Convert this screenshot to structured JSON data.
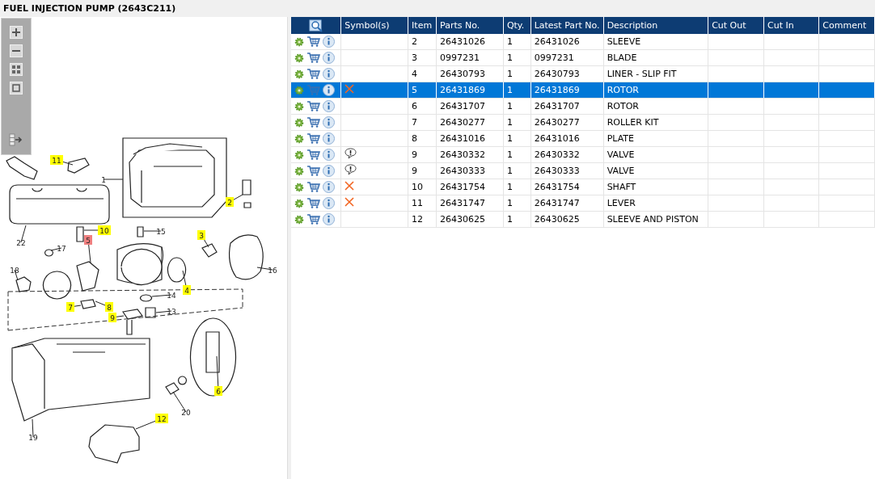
{
  "title": "FUEL INJECTION PUMP (2643C211)",
  "diagram": {
    "callouts": [
      {
        "label": "11",
        "highlighted": true,
        "selected": false
      },
      {
        "label": "1",
        "highlighted": false,
        "selected": false
      },
      {
        "label": "2",
        "highlighted": true,
        "selected": false
      },
      {
        "label": "22",
        "highlighted": false,
        "selected": false
      },
      {
        "label": "10",
        "highlighted": true,
        "selected": false
      },
      {
        "label": "15",
        "highlighted": false,
        "selected": false
      },
      {
        "label": "3",
        "highlighted": true,
        "selected": false
      },
      {
        "label": "17",
        "highlighted": false,
        "selected": false
      },
      {
        "label": "5",
        "highlighted": true,
        "selected": true
      },
      {
        "label": "16",
        "highlighted": false,
        "selected": false
      },
      {
        "label": "18",
        "highlighted": false,
        "selected": false
      },
      {
        "label": "4",
        "highlighted": true,
        "selected": false
      },
      {
        "label": "14",
        "highlighted": false,
        "selected": false
      },
      {
        "label": "7",
        "highlighted": true,
        "selected": false
      },
      {
        "label": "8",
        "highlighted": true,
        "selected": false
      },
      {
        "label": "13",
        "highlighted": false,
        "selected": false
      },
      {
        "label": "9",
        "highlighted": true,
        "selected": false
      },
      {
        "label": "6",
        "highlighted": true,
        "selected": false
      },
      {
        "label": "20",
        "highlighted": false,
        "selected": false
      },
      {
        "label": "19",
        "highlighted": false,
        "selected": false
      },
      {
        "label": "12",
        "highlighted": true,
        "selected": false
      }
    ]
  },
  "table": {
    "columns": [
      "Symbol(s)",
      "Item",
      "Parts No.",
      "Qty.",
      "Latest Part No.",
      "Description",
      "Cut Out",
      "Cut In",
      "Comment"
    ],
    "rows": [
      {
        "selected": false,
        "cross_symbol": false,
        "note_symbol": false,
        "item": "2",
        "part_no": "26431026",
        "qty": "1",
        "latest_part_no": "26431026",
        "description": "SLEEVE"
      },
      {
        "selected": false,
        "cross_symbol": false,
        "note_symbol": false,
        "item": "3",
        "part_no": "0997231",
        "qty": "1",
        "latest_part_no": "0997231",
        "description": "BLADE"
      },
      {
        "selected": false,
        "cross_symbol": false,
        "note_symbol": false,
        "item": "4",
        "part_no": "26430793",
        "qty": "1",
        "latest_part_no": "26430793",
        "description": "LINER - SLIP FIT"
      },
      {
        "selected": true,
        "cross_symbol": true,
        "note_symbol": false,
        "item": "5",
        "part_no": "26431869",
        "qty": "1",
        "latest_part_no": "26431869",
        "description": "ROTOR"
      },
      {
        "selected": false,
        "cross_symbol": false,
        "note_symbol": false,
        "item": "6",
        "part_no": "26431707",
        "qty": "1",
        "latest_part_no": "26431707",
        "description": "ROTOR"
      },
      {
        "selected": false,
        "cross_symbol": false,
        "note_symbol": false,
        "item": "7",
        "part_no": "26430277",
        "qty": "1",
        "latest_part_no": "26430277",
        "description": "ROLLER KIT"
      },
      {
        "selected": false,
        "cross_symbol": false,
        "note_symbol": false,
        "item": "8",
        "part_no": "26431016",
        "qty": "1",
        "latest_part_no": "26431016",
        "description": "PLATE"
      },
      {
        "selected": false,
        "cross_symbol": false,
        "note_symbol": true,
        "item": "9",
        "part_no": "26430332",
        "qty": "1",
        "latest_part_no": "26430332",
        "description": "VALVE"
      },
      {
        "selected": false,
        "cross_symbol": false,
        "note_symbol": true,
        "item": "9",
        "part_no": "26430333",
        "qty": "1",
        "latest_part_no": "26430333",
        "description": "VALVE"
      },
      {
        "selected": false,
        "cross_symbol": true,
        "note_symbol": false,
        "item": "10",
        "part_no": "26431754",
        "qty": "1",
        "latest_part_no": "26431754",
        "description": "SHAFT"
      },
      {
        "selected": false,
        "cross_symbol": true,
        "note_symbol": false,
        "item": "11",
        "part_no": "26431747",
        "qty": "1",
        "latest_part_no": "26431747",
        "description": "LEVER"
      },
      {
        "selected": false,
        "cross_symbol": false,
        "note_symbol": false,
        "item": "12",
        "part_no": "26430625",
        "qty": "1",
        "latest_part_no": "26430625",
        "description": "SLEEVE AND PISTON"
      }
    ]
  }
}
